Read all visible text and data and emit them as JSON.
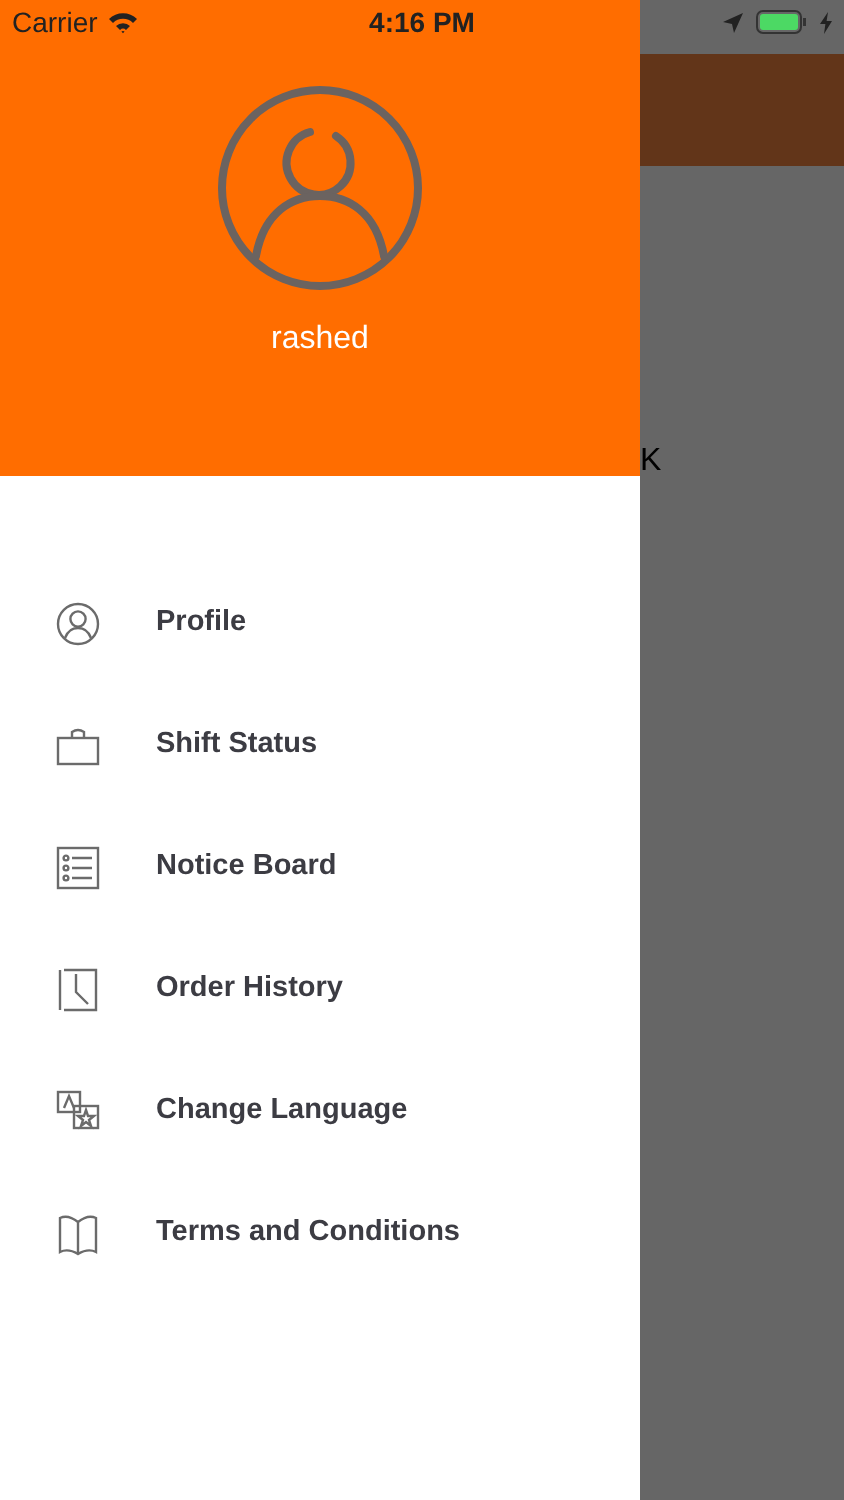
{
  "status_bar": {
    "carrier": "Carrier",
    "time": "4:16 PM"
  },
  "drawer": {
    "user_name": "rashed",
    "menu_items": [
      {
        "label": "Profile"
      },
      {
        "label": "Shift Status"
      },
      {
        "label": "Notice Board"
      },
      {
        "label": "Order History"
      },
      {
        "label": "Change Language"
      },
      {
        "label": "Terms and Conditions"
      }
    ]
  },
  "background": {
    "text": "K"
  }
}
